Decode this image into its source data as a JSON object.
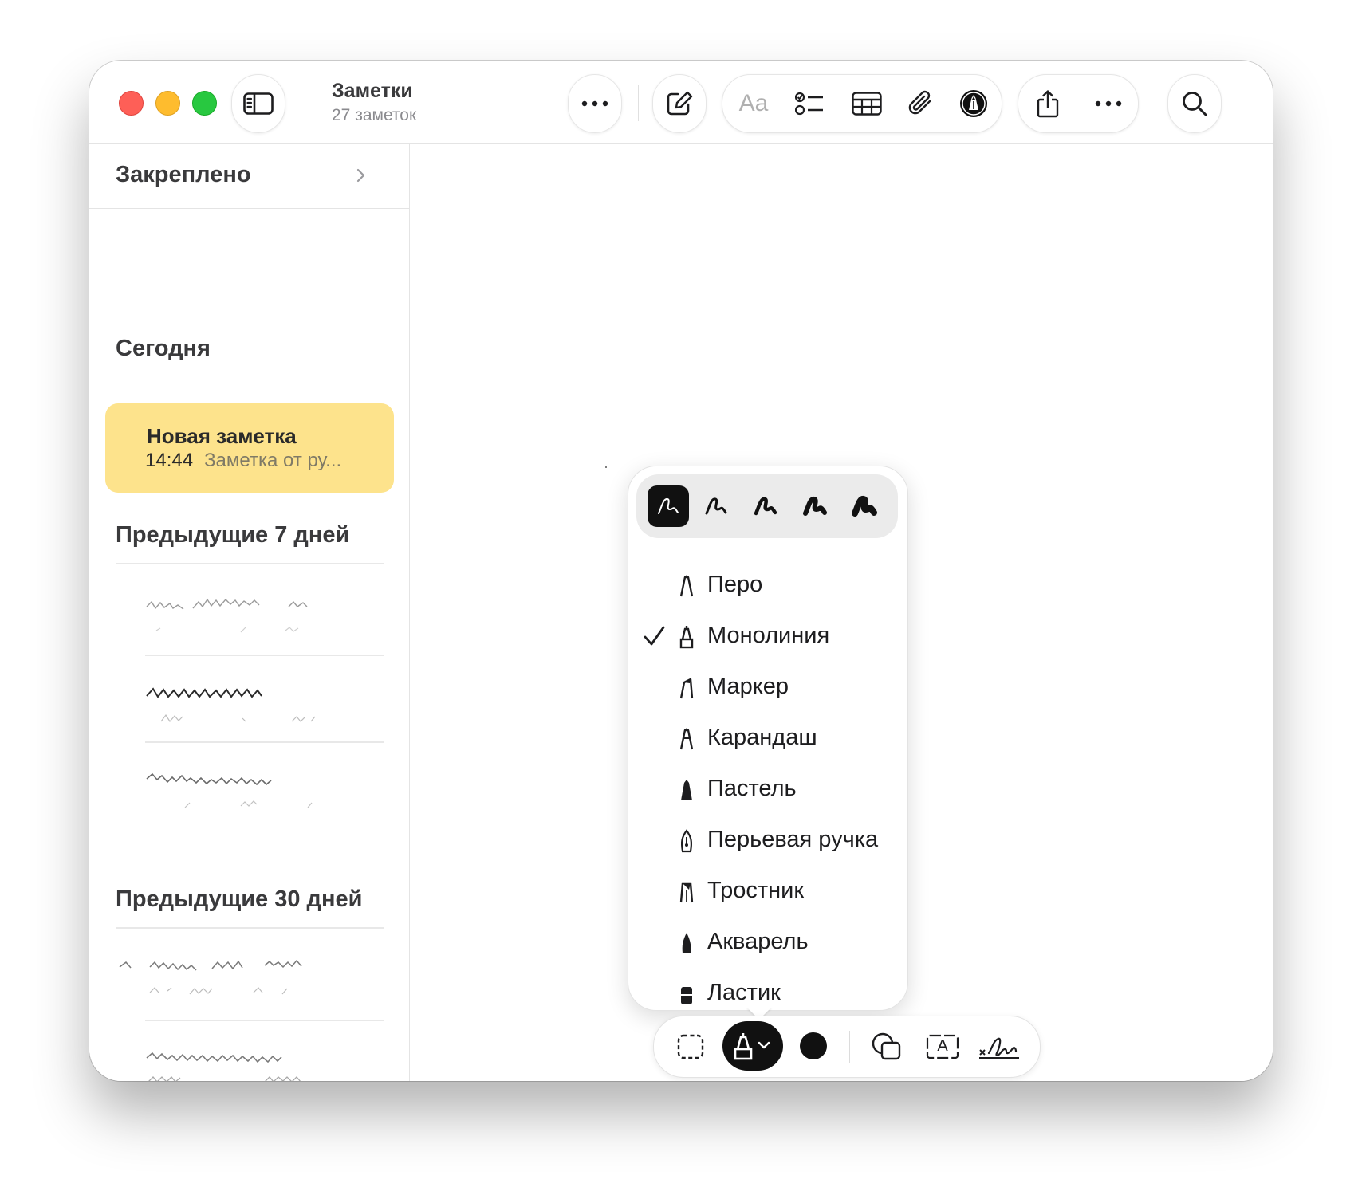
{
  "window": {
    "title": "Заметки",
    "subtitle": "27 заметок"
  },
  "toolbar": {
    "icons": [
      "sidebar-toggle-icon",
      "more-icon",
      "compose-icon",
      "text-format-icon",
      "checklist-icon",
      "table-icon",
      "attachment-icon",
      "markup-icon",
      "share-icon",
      "more-icon",
      "search-icon"
    ],
    "text_format_label": "Aa"
  },
  "sidebar": {
    "pinned_label": "Закреплено",
    "sections": {
      "today": "Сегодня",
      "prev7": "Предыдущие 7 дней",
      "prev30": "Предыдущие 30 дней"
    },
    "selected_note": {
      "title": "Новая заметка",
      "time": "14:44",
      "preview": "Заметка от ру..."
    }
  },
  "tool_menu": {
    "stroke_widths": [
      "width-1",
      "width-2",
      "width-3",
      "width-4",
      "width-5"
    ],
    "selected_width_index": 0,
    "selected_tool": "Монолиния",
    "items": [
      {
        "label": "Перо",
        "icon": "pen-icon",
        "checked": false
      },
      {
        "label": "Монолиния",
        "icon": "monoline-icon",
        "checked": true
      },
      {
        "label": "Маркер",
        "icon": "marker-icon",
        "checked": false
      },
      {
        "label": "Карандаш",
        "icon": "pencil-icon",
        "checked": false
      },
      {
        "label": "Пастель",
        "icon": "crayon-icon",
        "checked": false
      },
      {
        "label": "Перьевая ручка",
        "icon": "fountain-pen-icon",
        "checked": false
      },
      {
        "label": "Тростник",
        "icon": "reed-pen-icon",
        "checked": false
      },
      {
        "label": "Акварель",
        "icon": "watercolor-icon",
        "checked": false
      },
      {
        "label": "Ластик",
        "icon": "eraser-icon",
        "checked": false
      }
    ]
  },
  "drawing_toolbar": {
    "icons": [
      "lasso-select-icon",
      "monoline-tool-icon",
      "color-picker",
      "shapes-icon",
      "text-box-icon",
      "signature-icon"
    ],
    "text_box_glyph": "A",
    "color": "#111111",
    "selected_tool_bg": "#111111"
  },
  "colors": {
    "selected_note_bg": "#fde38c",
    "close": "#fe5f57",
    "minimize": "#febc2e",
    "maximize": "#28c840"
  }
}
